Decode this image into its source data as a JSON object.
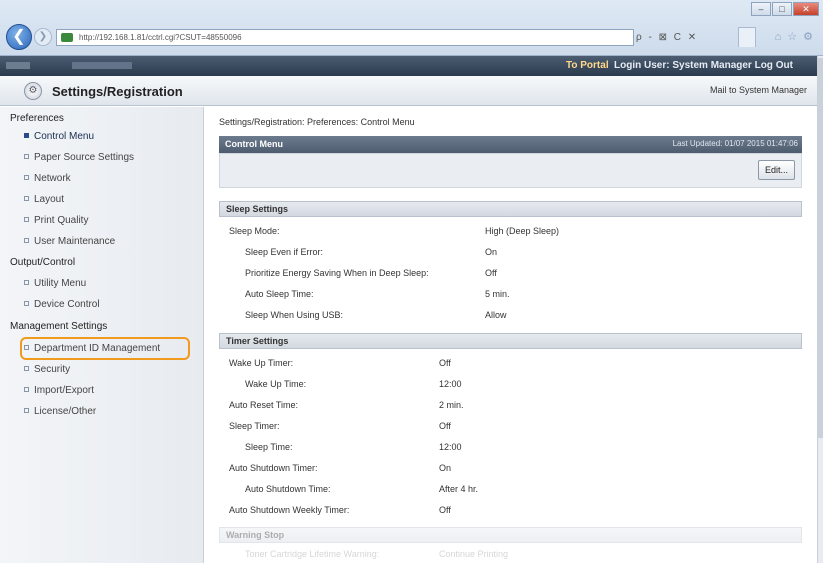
{
  "browser": {
    "url": "http://192.168.1.81/cctrl.cgi?CSUT=48550096",
    "address_tools": "ρ - ⊠ C ✕",
    "window_controls": [
      "–",
      "□",
      "✕"
    ]
  },
  "topbar": {
    "portal_link": "To Portal",
    "login_info": "Login User: System Manager Log Out"
  },
  "header": {
    "title": "Settings/Registration",
    "mail_link": "Mail to System Manager"
  },
  "sidebar": {
    "sections": [
      {
        "label": "Preferences",
        "items": [
          "Control Menu",
          "Paper Source Settings",
          "Network",
          "Layout",
          "Print Quality",
          "User Maintenance"
        ]
      },
      {
        "label": "Output/Control",
        "items": [
          "Utility Menu",
          "Device Control"
        ]
      },
      {
        "label": "Management Settings",
        "items": [
          "Department ID Management",
          "Security",
          "Import/Export",
          "License/Other"
        ]
      }
    ]
  },
  "main": {
    "breadcrumb": "Settings/Registration: Preferences: Control Menu",
    "panel_title": "Control Menu",
    "last_updated": "Last Updated: 01/07 2015 01:47:06",
    "edit_button": "Edit...",
    "sleep": {
      "heading": "Sleep Settings",
      "rows": [
        {
          "label": "Sleep Mode:",
          "value": "High (Deep Sleep)"
        },
        {
          "label": "Sleep Even if Error:",
          "value": "On"
        },
        {
          "label": "Prioritize Energy Saving When in Deep Sleep:",
          "value": "Off"
        },
        {
          "label": "Auto Sleep Time:",
          "value": "5 min."
        },
        {
          "label": "Sleep When Using USB:",
          "value": "Allow"
        }
      ]
    },
    "timer": {
      "heading": "Timer Settings",
      "rows": [
        {
          "label": "Wake Up Timer:",
          "value": "Off"
        },
        {
          "label": "Wake Up Time:",
          "value": "12:00"
        },
        {
          "label": "Auto Reset Time:",
          "value": "2 min."
        },
        {
          "label": "Sleep Timer:",
          "value": "Off"
        },
        {
          "label": "Sleep Time:",
          "value": "12:00"
        },
        {
          "label": "Auto Shutdown Timer:",
          "value": "On"
        },
        {
          "label": "Auto Shutdown Time:",
          "value": "After 4 hr."
        },
        {
          "label": "Auto Shutdown Weekly Timer:",
          "value": "Off"
        }
      ]
    },
    "warning": {
      "heading": "Warning Stop",
      "rows": [
        {
          "label": "Toner Cartridge Lifetime Warning:",
          "value": "Continue Printing"
        }
      ]
    }
  },
  "colors": {
    "highlight": "#f09b1e",
    "topbar": "#2b3a4d",
    "portal": "#ffd98a"
  }
}
